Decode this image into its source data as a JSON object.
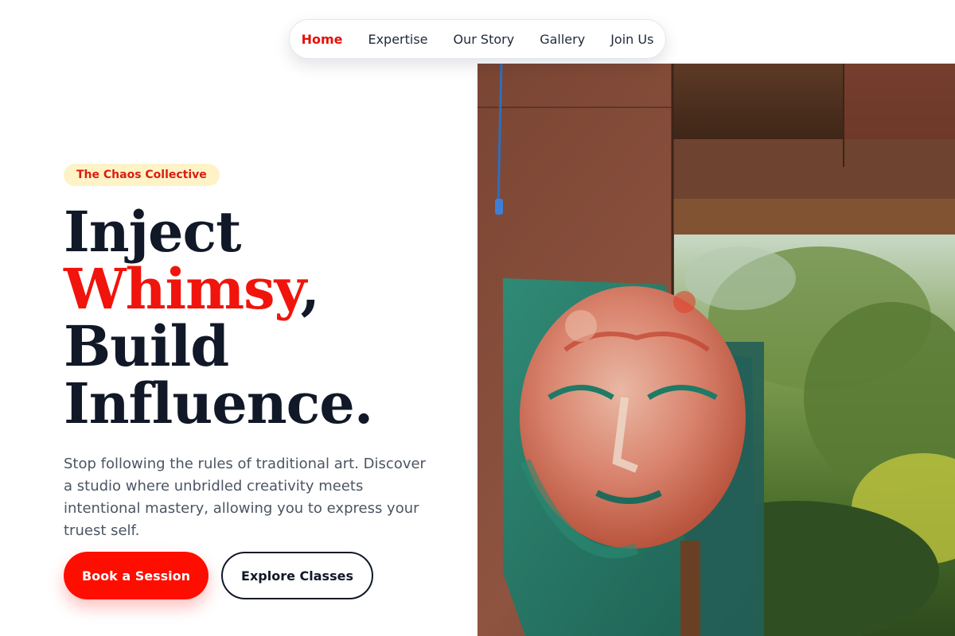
{
  "nav": {
    "items": [
      {
        "label": "Home",
        "active": true
      },
      {
        "label": "Expertise",
        "active": false
      },
      {
        "label": "Our Story",
        "active": false
      },
      {
        "label": "Gallery",
        "active": false
      },
      {
        "label": "Join Us",
        "active": false
      }
    ]
  },
  "hero": {
    "badge": "The Chaos Collective",
    "headline": {
      "line1": "Inject",
      "accent": "Whimsy",
      "comma": ",",
      "line3": "Build",
      "line4": "Influence."
    },
    "description": "Stop following the rules of traditional art. Discover a studio where unbridled creativity meets intentional mastery, allowing you to express your truest self.",
    "primary_button": "Book a Session",
    "secondary_button": "Explore Classes"
  },
  "colors": {
    "accent": "#ff0d00",
    "heading": "#111827",
    "badge_bg": "#fef3c7"
  }
}
